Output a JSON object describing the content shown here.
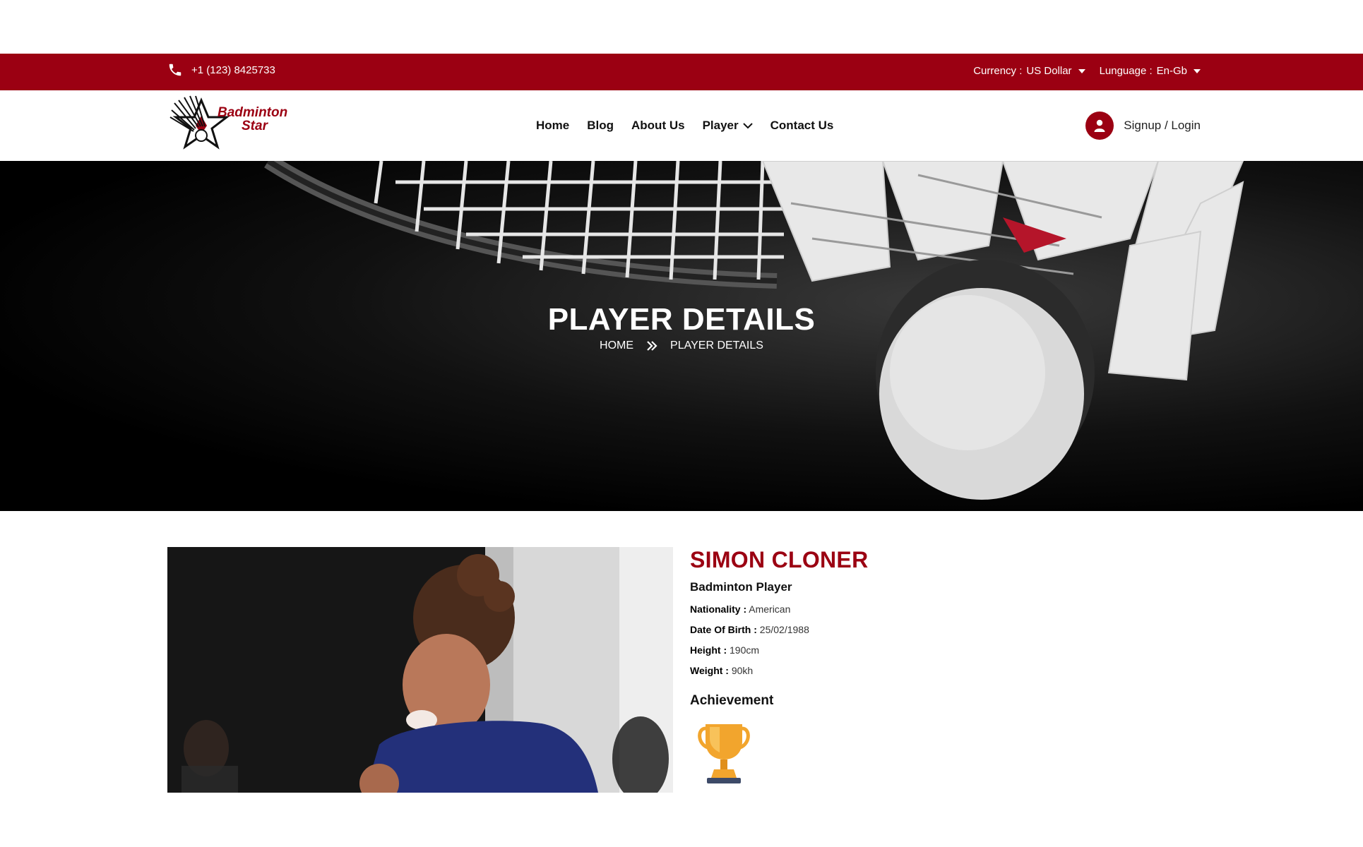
{
  "topbar": {
    "phone": "+1 (123) 8425733",
    "currency_label": "Currency :",
    "currency_value": "US Dollar",
    "language_label": "Lunguage :",
    "language_value": "En-Gb"
  },
  "header": {
    "logo_line1": "Badminton",
    "logo_line2": "Star",
    "nav": [
      "Home",
      "Blog",
      "About Us",
      "Player",
      "Contact Us"
    ],
    "account_label": "Signup / Login"
  },
  "hero": {
    "title": "PLAYER DETAILS",
    "breadcrumb_home": "HOME",
    "breadcrumb_current": "PLAYER DETAILS"
  },
  "player": {
    "name": "SIMON CLONER",
    "role": "Badminton Player",
    "nationality_label": "Nationality :",
    "nationality": "American",
    "dob_label": "Date Of Birth :",
    "dob": "25/02/1988",
    "height_label": "Height :",
    "height": "190cm",
    "weight_label": "Weight :",
    "weight": "90kh",
    "achievement_title": "Achievement"
  },
  "colors": {
    "brand": "#9b0012",
    "trophy": "#f2a52d"
  },
  "icons": [
    "phone-icon",
    "caret-down-icon",
    "chevron-down-icon",
    "user-icon",
    "double-chevron-right-icon",
    "trophy-icon"
  ]
}
